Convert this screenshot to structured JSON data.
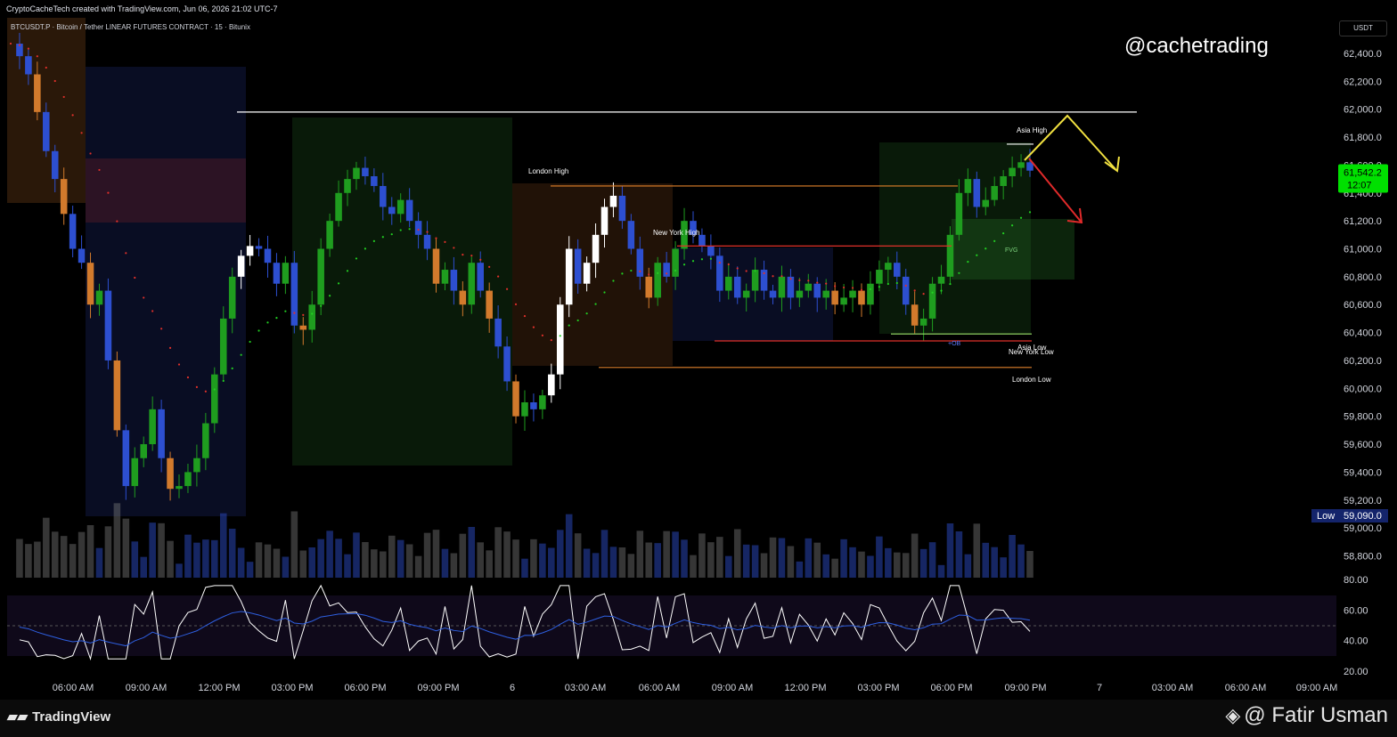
{
  "header": {
    "credit": "CryptoCacheTech created with TradingView.com, Jun 06, 2026 21:02 UTC-7",
    "symbol": "BTCUSDT.P · Bitcoin / Tether LINEAR FUTURES CONTRACT · 15 · Bitunix",
    "currency_button": "USDT",
    "handle": "@cachetrading"
  },
  "footer": {
    "brand": "TradingView",
    "author": "@ Fatir Usman"
  },
  "colors": {
    "background": "#000000",
    "bull": "#1f9d1f",
    "bear": "#2d4fd0",
    "bear_orange": "#d27a2c",
    "bear_red": "#b02a2a",
    "ema_up": "#22d022",
    "ema_down": "#e0302a",
    "price_tag": "#00e000",
    "rsi": "#ffffff",
    "rsi_ma": "#2e5fe0"
  },
  "chart_data": {
    "type": "candlestick",
    "symbol": "BTCUSDT.P",
    "interval": "15",
    "y_axis": {
      "ticks": [
        62400,
        62200,
        62000,
        61800,
        61600,
        61400,
        61200,
        61000,
        60800,
        60600,
        60400,
        60200,
        60000,
        59800,
        59600,
        59400,
        59200,
        59000,
        58800
      ],
      "tick_labels": [
        "62,400.0",
        "62,200.0",
        "62,000.0",
        "61,800.0",
        "61,600.0",
        "61,400.0",
        "61,200.0",
        "61,000.0",
        "60,800.0",
        "60,600.0",
        "60,400.0",
        "60,200.0",
        "60,000.0",
        "59,800.0",
        "59,600.0",
        "59,400.0",
        "59,200.0",
        "59,000.0",
        "58,800.0"
      ],
      "range": [
        58750,
        62500
      ]
    },
    "x_axis": {
      "tick_labels": [
        "06:00 AM",
        "09:00 AM",
        "12:00 PM",
        "03:00 PM",
        "06:00 PM",
        "09:00 PM",
        "6",
        "03:00 AM",
        "06:00 AM",
        "09:00 AM",
        "12:00 PM",
        "03:00 PM",
        "06:00 PM",
        "09:00 PM",
        "7",
        "03:00 AM",
        "06:00 AM",
        "09:00 AM"
      ]
    },
    "last_price": {
      "label": "61,542.2",
      "countdown": "12:07",
      "value": 61542.2
    },
    "low_marker": {
      "label": "Low",
      "value_label": "59,090.0",
      "value": 59090
    },
    "levels": [
      {
        "name": "resistance",
        "value": 61980,
        "color": "#ffffff"
      },
      {
        "name": "London High",
        "value": 61450,
        "color": "#e0802a"
      },
      {
        "name": "New York High",
        "value": 61020,
        "color": "#e0302a"
      },
      {
        "name": "Asia High",
        "value": 61750,
        "color": "#ffffff"
      },
      {
        "name": "Asia Low",
        "value": 60390,
        "color": "#9be36a"
      },
      {
        "name": "New York Low",
        "value": 60340,
        "color": "#e0302a"
      },
      {
        "name": "London Low",
        "value": 60150,
        "color": "#e0802a"
      }
    ],
    "labels": {
      "asia_high": "Asia High",
      "london_high": "London High",
      "new_york_high": "New York High",
      "asia_low": "Asia Low",
      "new_york_low": "New York Low",
      "london_low": "London Low",
      "fvg": "FVG",
      "ob": "+OB"
    },
    "rsi": {
      "ticks": [
        80,
        60,
        40,
        20
      ],
      "tick_labels": [
        "80.00",
        "60.00",
        "40.00",
        "20.00"
      ],
      "upper_band": 70,
      "lower_band": 30
    },
    "close_path": [
      62470,
      62380,
      62250,
      61980,
      61700,
      61500,
      61250,
      61000,
      60900,
      60600,
      60700,
      60200,
      59700,
      59300,
      59500,
      59600,
      59850,
      59500,
      59280,
      59300,
      59400,
      59500,
      59750,
      60100,
      60500,
      60800,
      60950,
      61020,
      61000,
      60900,
      60750,
      60900,
      60450,
      60420,
      60600,
      61000,
      61200,
      61400,
      61500,
      61580,
      61520,
      61450,
      61300,
      61250,
      61350,
      61200,
      61100,
      61000,
      60750,
      60850,
      60700,
      60600,
      60900,
      60700,
      60500,
      60300,
      60050,
      59800,
      59900,
      59850,
      59950,
      60100,
      60600,
      61000,
      60750,
      60900,
      61100,
      61300,
      61380,
      61200,
      61000,
      60800,
      60650,
      60900,
      60800,
      61000,
      61200,
      61100,
      61020,
      60950,
      60700,
      60800,
      60650,
      60700,
      60850,
      60700,
      60650,
      60800,
      60650,
      60700,
      60750,
      60650,
      60700,
      60600,
      60650,
      60700,
      60600,
      60750,
      60850,
      60900,
      60800,
      60600,
      60450,
      60500,
      60750,
      60800,
      61100,
      61400,
      61500,
      61300,
      61350,
      61450,
      61520,
      61580,
      61620,
      61560
    ]
  }
}
